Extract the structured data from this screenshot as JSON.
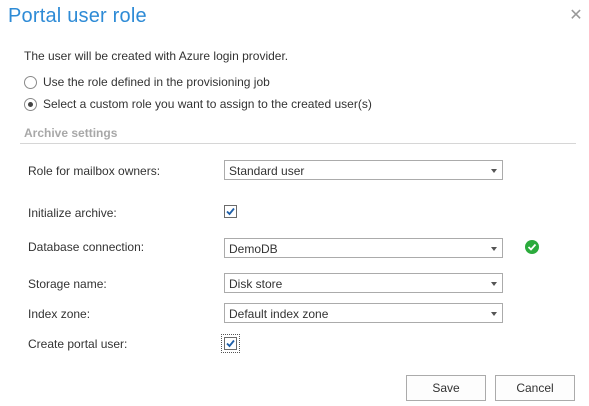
{
  "dialog": {
    "title": "Portal user role",
    "info_text": "The user will be created with Azure login provider."
  },
  "role_options": [
    {
      "label": "Use the role defined in the provisioning job",
      "selected": false
    },
    {
      "label": "Select a custom role you want to assign to the created user(s)",
      "selected": true
    }
  ],
  "archive": {
    "section_title": "Archive settings",
    "role_label": "Role for mailbox owners:",
    "role_value": "Standard user",
    "initialize_label": "Initialize archive:",
    "initialize_checked": true,
    "database_label": "Database connection:",
    "database_value": "DemoDB",
    "database_status_icon": "check-circle-icon",
    "database_status_color": "#2bab3c",
    "storage_label": "Storage name:",
    "storage_value": "Disk store",
    "index_label": "Index zone:",
    "index_value": "Default index zone",
    "create_label": "Create portal user:",
    "create_checked": true
  },
  "buttons": {
    "save": "Save",
    "cancel": "Cancel"
  },
  "colors": {
    "title": "#2e8bd6",
    "checkmark": "#1e5fa8"
  }
}
